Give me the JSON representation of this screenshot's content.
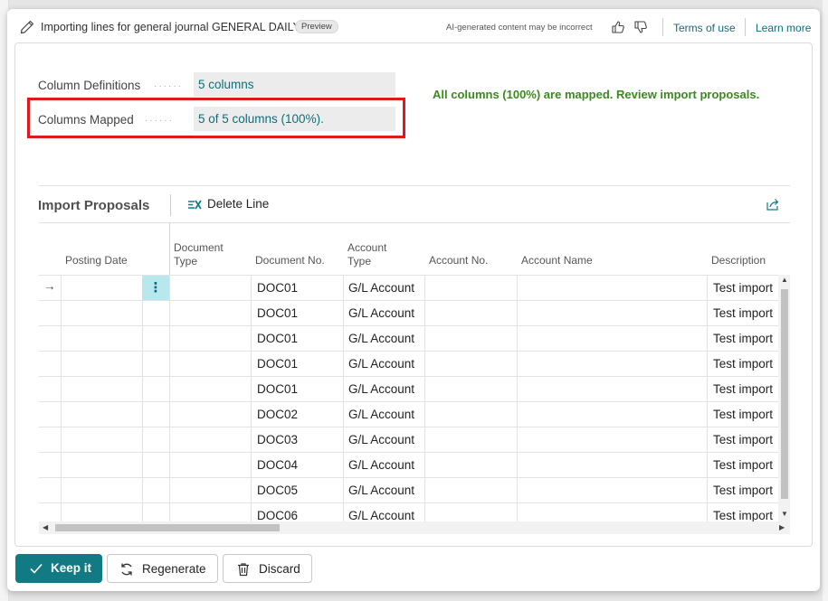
{
  "header": {
    "title": "Importing lines for general journal GENERAL DAILY",
    "badge": "Preview",
    "ai_note": "AI-generated content may be incorrect",
    "terms_link": "Terms of use",
    "learn_link": "Learn more"
  },
  "summary": {
    "column_definitions_label": "Column Definitions",
    "column_definitions_value": "5 columns",
    "columns_mapped_label": "Columns Mapped",
    "columns_mapped_value": "5 of 5 columns (100%).",
    "status_message": "All columns (100%) are mapped. Review import proposals."
  },
  "proposals": {
    "title": "Import Proposals",
    "delete_label": "Delete Line",
    "columns": {
      "posting_date": "Posting Date",
      "document_type_1": "Document",
      "document_type_2": "Type",
      "document_no": "Document No.",
      "account_type_1": "Account",
      "account_type_2": "Type",
      "account_no": "Account No.",
      "account_name": "Account Name",
      "description": "Description"
    },
    "rows": [
      {
        "document_no": "DOC01",
        "account_type": "G/L Account",
        "description": "Test import"
      },
      {
        "document_no": "DOC01",
        "account_type": "G/L Account",
        "description": "Test import"
      },
      {
        "document_no": "DOC01",
        "account_type": "G/L Account",
        "description": "Test import"
      },
      {
        "document_no": "DOC01",
        "account_type": "G/L Account",
        "description": "Test import"
      },
      {
        "document_no": "DOC01",
        "account_type": "G/L Account",
        "description": "Test import"
      },
      {
        "document_no": "DOC02",
        "account_type": "G/L Account",
        "description": "Test import"
      },
      {
        "document_no": "DOC03",
        "account_type": "G/L Account",
        "description": "Test import"
      },
      {
        "document_no": "DOC04",
        "account_type": "G/L Account",
        "description": "Test import"
      },
      {
        "document_no": "DOC05",
        "account_type": "G/L Account",
        "description": "Test import"
      },
      {
        "document_no": "DOC06",
        "account_type": "G/L Account",
        "description": "Test import"
      }
    ]
  },
  "actions": {
    "keep": "Keep it",
    "regenerate": "Regenerate",
    "discard": "Discard"
  },
  "colors": {
    "accent": "#127a83",
    "link": "#0f6e7a",
    "success": "#3a8a1e",
    "highlight": "#e0191f"
  }
}
